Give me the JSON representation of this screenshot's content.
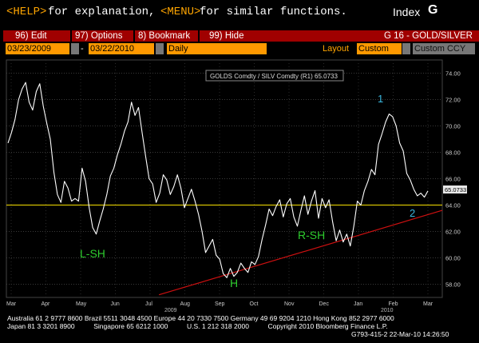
{
  "topline": {
    "help_key": "<HELP>",
    "help_text": "for explanation,",
    "menu_key": "<MENU>",
    "menu_text": "for similar functions.",
    "index_label": "Index",
    "index_key": "G"
  },
  "menubar": {
    "items": [
      "96) Edit",
      "97) Options",
      "8) Bookmark",
      "99) Hide"
    ],
    "title": "G 16 - GOLD/SILVER"
  },
  "fields": {
    "start_date": "03/23/2009",
    "dash": "-",
    "end_date": "03/22/2010",
    "period": "Daily",
    "layout_label": "Layout",
    "layout_value": "Custom",
    "currency": "Custom CCY"
  },
  "chart": {
    "legend": "GOLDS Comdty / SILV Comdty (R1)  65.0733",
    "last_value": "65.0733",
    "annotations": {
      "lsh": "L-SH",
      "h": "H",
      "rsh": "R-SH",
      "one": "1",
      "two": "2"
    },
    "year_labels": {
      "y2009": "2009",
      "y2010": "2010"
    }
  },
  "chart_data": {
    "type": "line",
    "title": "GOLDS Comdty / SILV Comdty (R1)",
    "x": [
      "Mar",
      "Apr",
      "May",
      "Jun",
      "Jul",
      "Aug",
      "Sep",
      "Oct",
      "Nov",
      "Dec",
      "Jan",
      "Feb",
      "Mar"
    ],
    "yticks": [
      58,
      60,
      62,
      64,
      66,
      68,
      70,
      72,
      74
    ],
    "ylim": [
      57,
      75
    ],
    "series": [
      {
        "values": [
          68.7,
          69.5,
          70.5,
          72.0,
          72.8,
          73.3,
          71.8,
          71.2,
          72.6,
          73.2,
          71.5,
          70.2,
          69.0,
          66.5,
          64.8,
          64.2,
          65.8,
          65.3,
          64.3,
          64.5,
          64.3,
          66.8,
          65.8,
          63.8,
          62.3,
          61.8,
          62.8,
          63.7,
          64.8,
          66.2,
          66.8,
          67.8,
          68.6,
          69.6,
          70.3,
          71.8,
          70.8,
          71.4,
          69.5,
          67.7,
          66.0,
          65.6,
          64.2,
          64.9,
          66.3,
          65.9,
          64.8,
          65.4,
          66.3,
          65.3,
          63.8,
          64.5,
          65.2,
          64.3,
          63.3,
          62.0,
          60.4,
          60.9,
          61.4,
          60.2,
          59.9,
          58.8,
          58.5,
          59.2,
          58.6,
          58.9,
          59.6,
          59.2,
          58.9,
          59.7,
          59.5,
          60.1,
          61.4,
          62.5,
          63.7,
          63.2,
          63.9,
          64.4,
          63.1,
          64.1,
          64.5,
          63.1,
          62.4,
          63.6,
          64.7,
          63.3,
          64.3,
          65.1,
          63.0,
          64.5,
          63.8,
          64.4,
          62.7,
          61.3,
          62.1,
          61.2,
          61.8,
          60.9,
          62.4,
          64.3,
          64.0,
          65.1,
          65.8,
          66.7,
          66.3,
          68.6,
          69.4,
          70.3,
          70.9,
          70.7,
          70.0,
          68.7,
          68.1,
          66.4,
          65.9,
          65.2,
          64.7,
          64.9,
          64.6,
          65.0733
        ],
        "color": "#ffffff"
      }
    ],
    "horizontal_line": {
      "value": 64.0,
      "color": "#d4c000"
    },
    "trendline": {
      "from": [
        0.35,
        57.2
      ],
      "to": [
        1.0,
        63.6
      ],
      "color": "#cc1010"
    },
    "grid": true
  },
  "footer": {
    "line1": "Australia 61 2 9777 8600 Brazil 5511 3048 4500 Europe 44 20 7330 7500 Germany 49 69 9204 1210 Hong Kong 852 2977 6000",
    "line2": "Japan 81 3 3201 8900          Singapore 65 6212 1000          U.S. 1 212 318 2000          Copyright 2010 Bloomberg Finance L.P.",
    "line3": "G793-415-2 22-Mar-10 14:26:50"
  },
  "colors": {
    "accent": "#ffa500",
    "menubar": "#a00000",
    "field": "#ff9900"
  }
}
